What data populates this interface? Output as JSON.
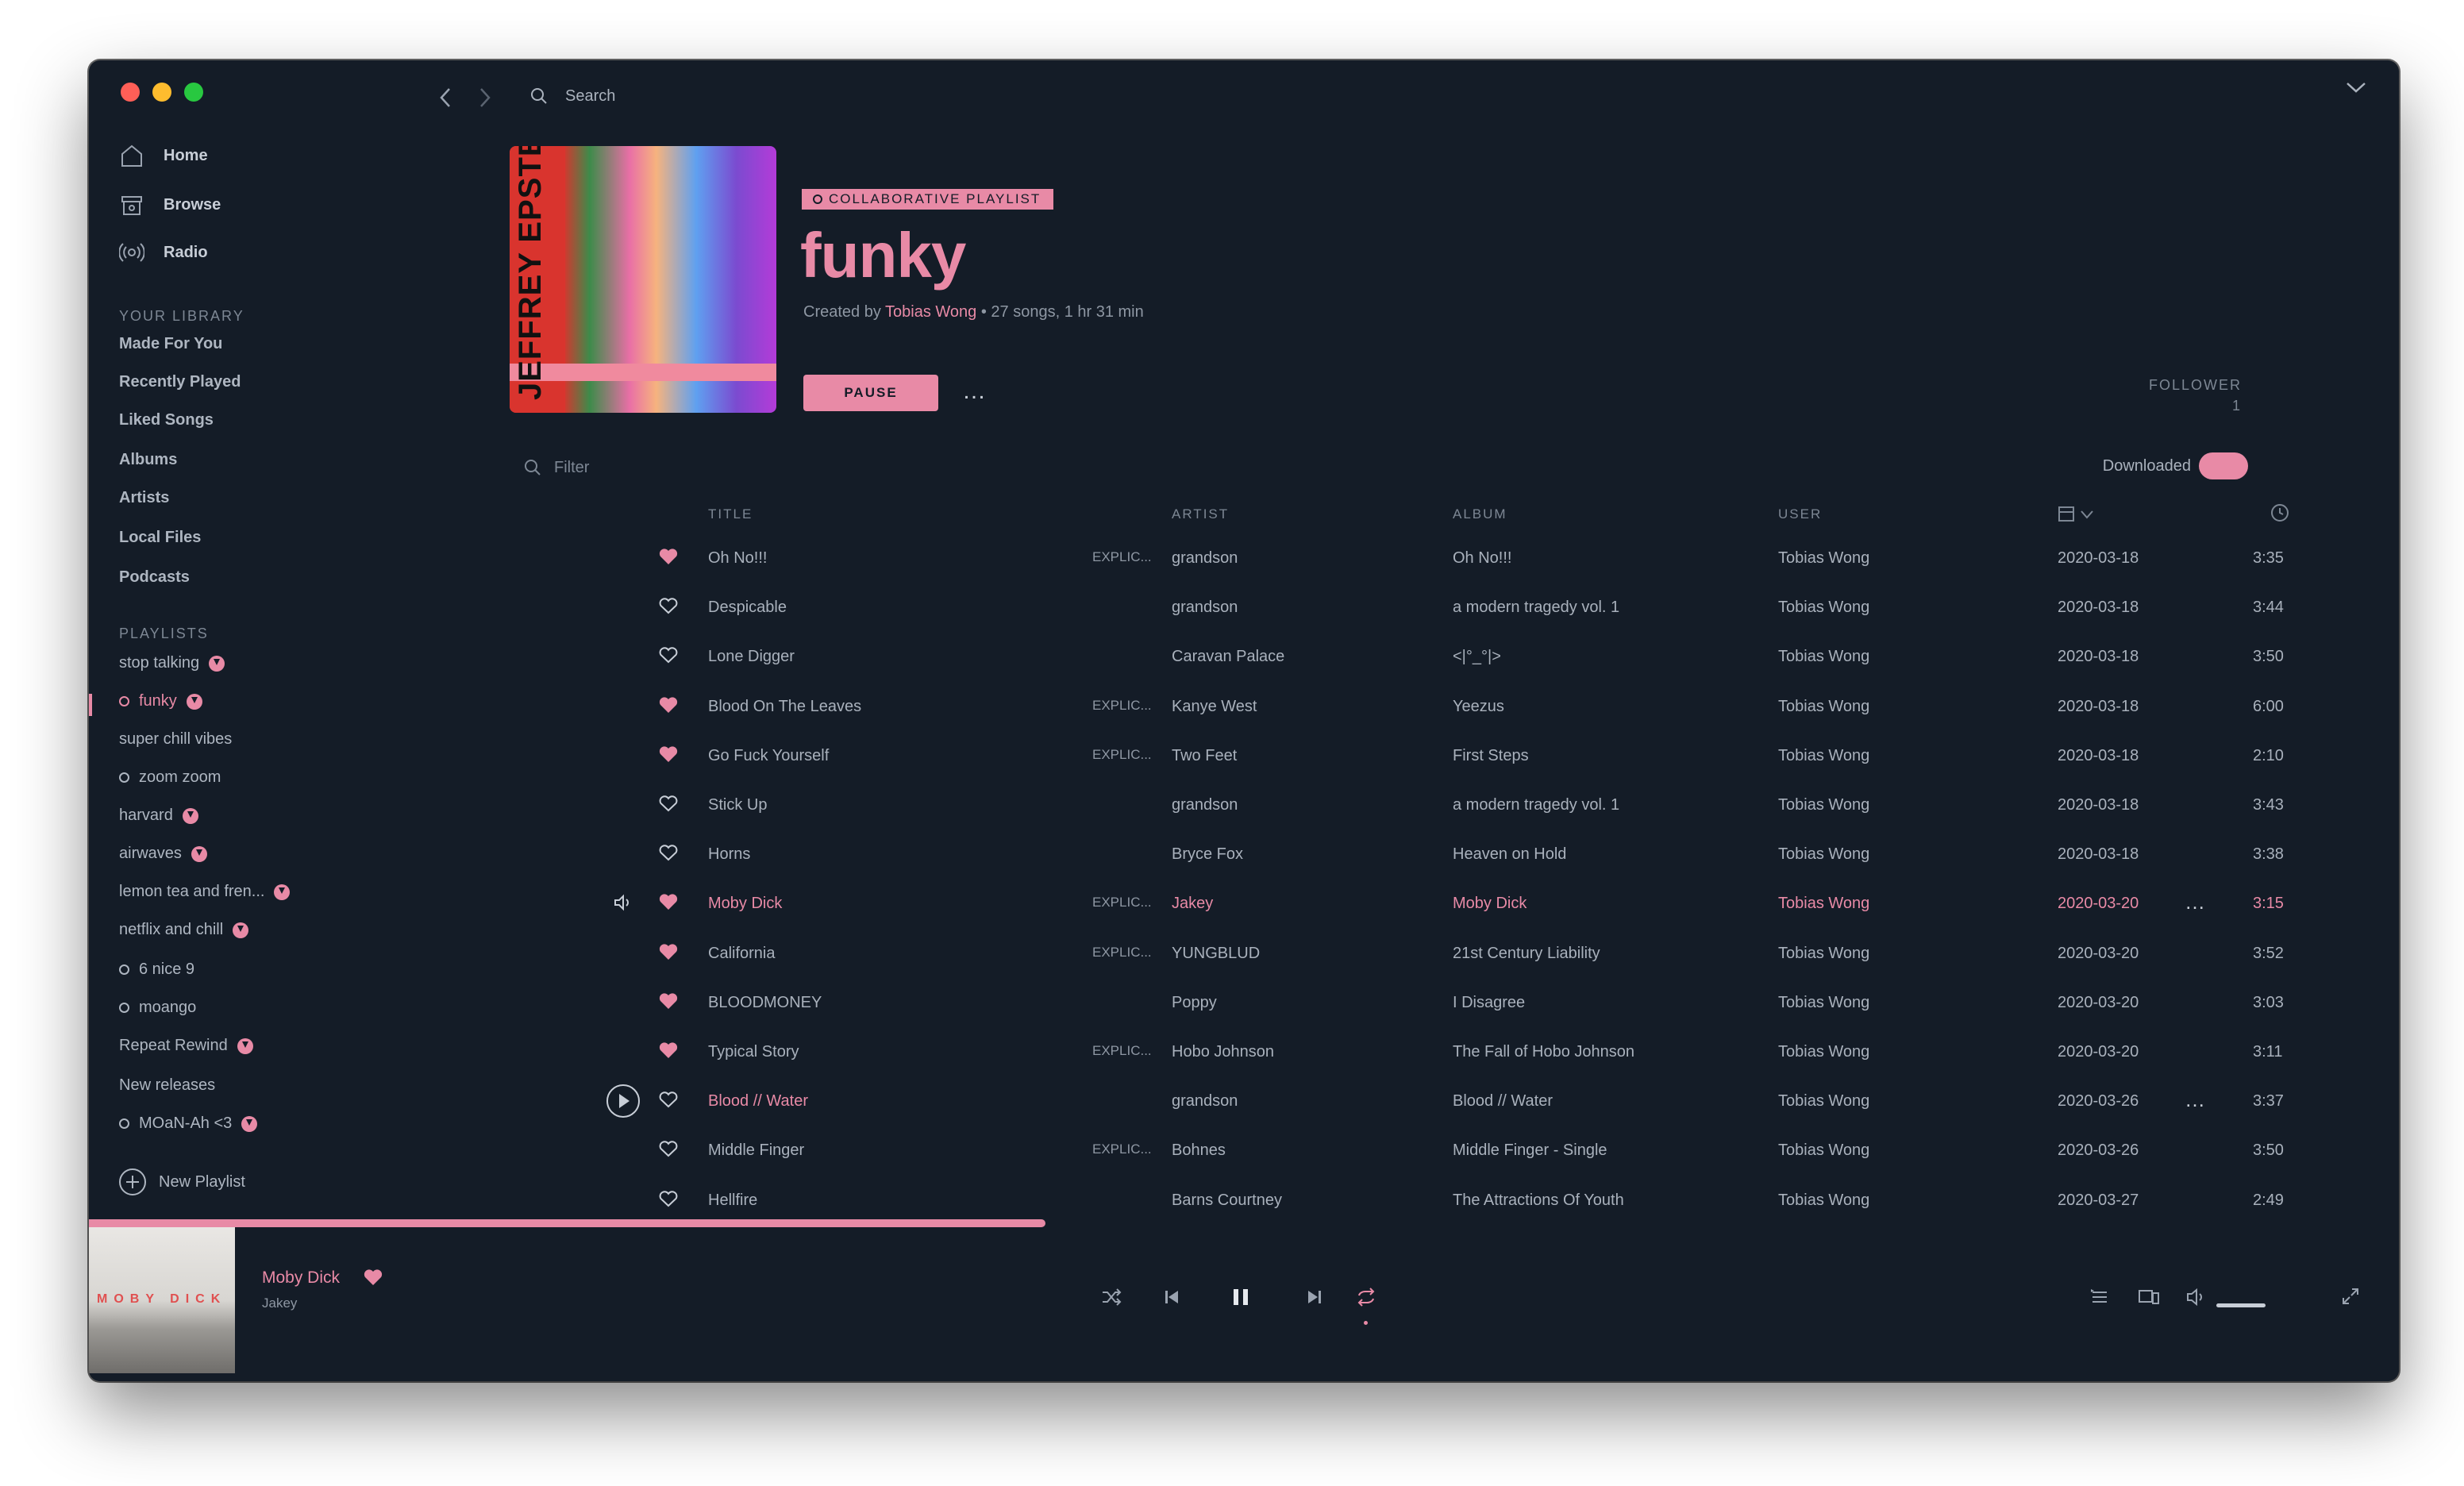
{
  "topbar": {
    "search_placeholder": "Search"
  },
  "sidebar": {
    "nav": [
      {
        "label": "Home",
        "icon": "home-icon"
      },
      {
        "label": "Browse",
        "icon": "browse-icon"
      },
      {
        "label": "Radio",
        "icon": "radio-icon"
      }
    ],
    "library_header": "YOUR LIBRARY",
    "library": [
      "Made For You",
      "Recently Played",
      "Liked Songs",
      "Albums",
      "Artists",
      "Local Files",
      "Podcasts"
    ],
    "playlists_header": "PLAYLISTS",
    "playlists": [
      {
        "label": "stop talking",
        "collab": false,
        "downloaded": true,
        "active": false
      },
      {
        "label": "funky",
        "collab": true,
        "downloaded": true,
        "active": true
      },
      {
        "label": "super chill vibes",
        "collab": false,
        "downloaded": false,
        "active": false
      },
      {
        "label": "zoom zoom",
        "collab": true,
        "downloaded": false,
        "active": false
      },
      {
        "label": "harvard",
        "collab": false,
        "downloaded": true,
        "active": false
      },
      {
        "label": "airwaves",
        "collab": false,
        "downloaded": true,
        "active": false
      },
      {
        "label": "lemon tea and fren...",
        "collab": false,
        "downloaded": true,
        "active": false
      },
      {
        "label": "netflix and chill",
        "collab": false,
        "downloaded": true,
        "active": false
      },
      {
        "label": "6 nice 9",
        "collab": true,
        "downloaded": false,
        "active": false
      },
      {
        "label": "moango",
        "collab": true,
        "downloaded": false,
        "active": false
      },
      {
        "label": "Repeat Rewind",
        "collab": false,
        "downloaded": true,
        "active": false
      },
      {
        "label": "New releases",
        "collab": false,
        "downloaded": false,
        "active": false
      },
      {
        "label": "MOaN-Ah <3",
        "collab": true,
        "downloaded": true,
        "active": false
      }
    ],
    "new_playlist": "New Playlist"
  },
  "playlist": {
    "cover_text": "JEFFREY EPSTEIN didntkillhimself",
    "badge": "COLLABORATIVE PLAYLIST",
    "title": "funky",
    "created_by_prefix": "Created by ",
    "creator": "Tobias Wong",
    "meta_suffix": " • 27 songs, 1 hr 31 min",
    "pause_label": "PAUSE",
    "more": "…",
    "follower_label": "FOLLOWER",
    "follower_count": "1",
    "filter_placeholder": "Filter",
    "downloaded_label": "Downloaded"
  },
  "table": {
    "headers": {
      "title": "TITLE",
      "artist": "ARTIST",
      "album": "ALBUM",
      "user": "USER"
    },
    "rows": [
      {
        "title": "Oh No!!!",
        "explicit": "EXPLIC...",
        "artist": "grandson",
        "album": "Oh No!!!",
        "user": "Tobias Wong",
        "date": "2020-03-18",
        "duration": "3:35",
        "liked": true
      },
      {
        "title": "Despicable",
        "explicit": "",
        "artist": "grandson",
        "album": "a modern tragedy vol. 1",
        "user": "Tobias Wong",
        "date": "2020-03-18",
        "duration": "3:44",
        "liked": false
      },
      {
        "title": "Lone Digger",
        "explicit": "",
        "artist": "Caravan Palace",
        "album": "<|°_°|>",
        "user": "Tobias Wong",
        "date": "2020-03-18",
        "duration": "3:50",
        "liked": false
      },
      {
        "title": "Blood On The Leaves",
        "explicit": "EXPLIC...",
        "artist": "Kanye West",
        "album": "Yeezus",
        "user": "Tobias Wong",
        "date": "2020-03-18",
        "duration": "6:00",
        "liked": true
      },
      {
        "title": "Go Fuck Yourself",
        "explicit": "EXPLIC...",
        "artist": "Two Feet",
        "album": "First Steps",
        "user": "Tobias Wong",
        "date": "2020-03-18",
        "duration": "2:10",
        "liked": true
      },
      {
        "title": "Stick Up",
        "explicit": "",
        "artist": "grandson",
        "album": "a modern tragedy vol. 1",
        "user": "Tobias Wong",
        "date": "2020-03-18",
        "duration": "3:43",
        "liked": false
      },
      {
        "title": "Horns",
        "explicit": "",
        "artist": "Bryce Fox",
        "album": "Heaven on Hold",
        "user": "Tobias Wong",
        "date": "2020-03-18",
        "duration": "3:38",
        "liked": false
      },
      {
        "title": "Moby Dick",
        "explicit": "EXPLIC...",
        "artist": "Jakey",
        "album": "Moby Dick",
        "user": "Tobias Wong",
        "date": "2020-03-20",
        "duration": "3:15",
        "liked": true,
        "playing": true
      },
      {
        "title": "California",
        "explicit": "EXPLIC...",
        "artist": "YUNGBLUD",
        "album": "21st Century Liability",
        "user": "Tobias Wong",
        "date": "2020-03-20",
        "duration": "3:52",
        "liked": true
      },
      {
        "title": "BLOODMONEY",
        "explicit": "",
        "artist": "Poppy",
        "album": "I Disagree",
        "user": "Tobias Wong",
        "date": "2020-03-20",
        "duration": "3:03",
        "liked": true
      },
      {
        "title": "Typical Story",
        "explicit": "EXPLIC...",
        "artist": "Hobo Johnson",
        "album": "The Fall of Hobo Johnson",
        "user": "Tobias Wong",
        "date": "2020-03-20",
        "duration": "3:11",
        "liked": true
      },
      {
        "title": "Blood // Water",
        "explicit": "",
        "artist": "grandson",
        "album": "Blood // Water",
        "user": "Tobias Wong",
        "date": "2020-03-26",
        "duration": "3:37",
        "liked": false,
        "hover": true
      },
      {
        "title": "Middle Finger",
        "explicit": "EXPLIC...",
        "artist": "Bohnes",
        "album": "Middle Finger - Single",
        "user": "Tobias Wong",
        "date": "2020-03-26",
        "duration": "3:50",
        "liked": false
      },
      {
        "title": "Hellfire",
        "explicit": "",
        "artist": "Barns Courtney",
        "album": "The Attractions Of Youth",
        "user": "Tobias Wong",
        "date": "2020-03-27",
        "duration": "2:49",
        "liked": false
      }
    ]
  },
  "player": {
    "art_text": "MOBY DICK",
    "title": "Moby Dick",
    "artist": "Jakey",
    "progress": 0.414,
    "volume": 1.0
  },
  "colors": {
    "accent": "#e88aa6",
    "background": "#141c27"
  }
}
